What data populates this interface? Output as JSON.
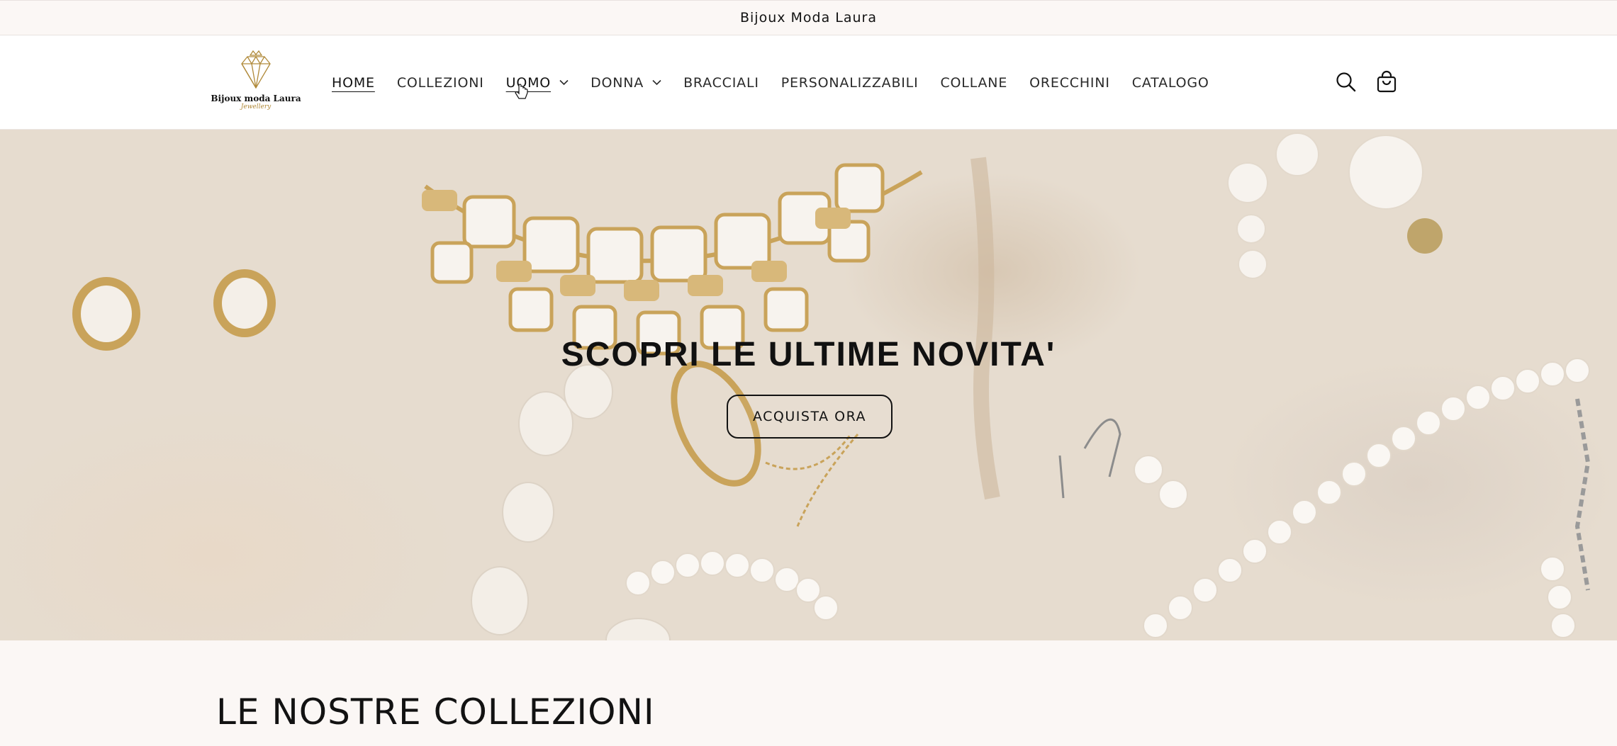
{
  "announcement": {
    "text": "Bijoux Moda Laura"
  },
  "logo": {
    "name": "Bijoux moda Laura",
    "subtitle": "Jewellery"
  },
  "nav": [
    {
      "label": "HOME"
    },
    {
      "label": "COLLEZIONI"
    },
    {
      "label": "UOMO"
    },
    {
      "label": "DONNA"
    },
    {
      "label": "BRACCIALI"
    },
    {
      "label": "PERSONALIZZABILI"
    },
    {
      "label": "COLLANE"
    },
    {
      "label": "ORECCHINI"
    },
    {
      "label": "CATALOGO"
    }
  ],
  "header_icons": {
    "search": "search-icon",
    "cart": "cart-icon"
  },
  "hero": {
    "title": "SCOPRI LE ULTIME NOVITA'",
    "button_label": "ACQUISTA ORA"
  },
  "collections": {
    "title": "LE NOSTRE COLLEZIONI"
  },
  "colors": {
    "background": "#fbf7f5",
    "text": "#121212",
    "gold": "#c9a35a"
  }
}
